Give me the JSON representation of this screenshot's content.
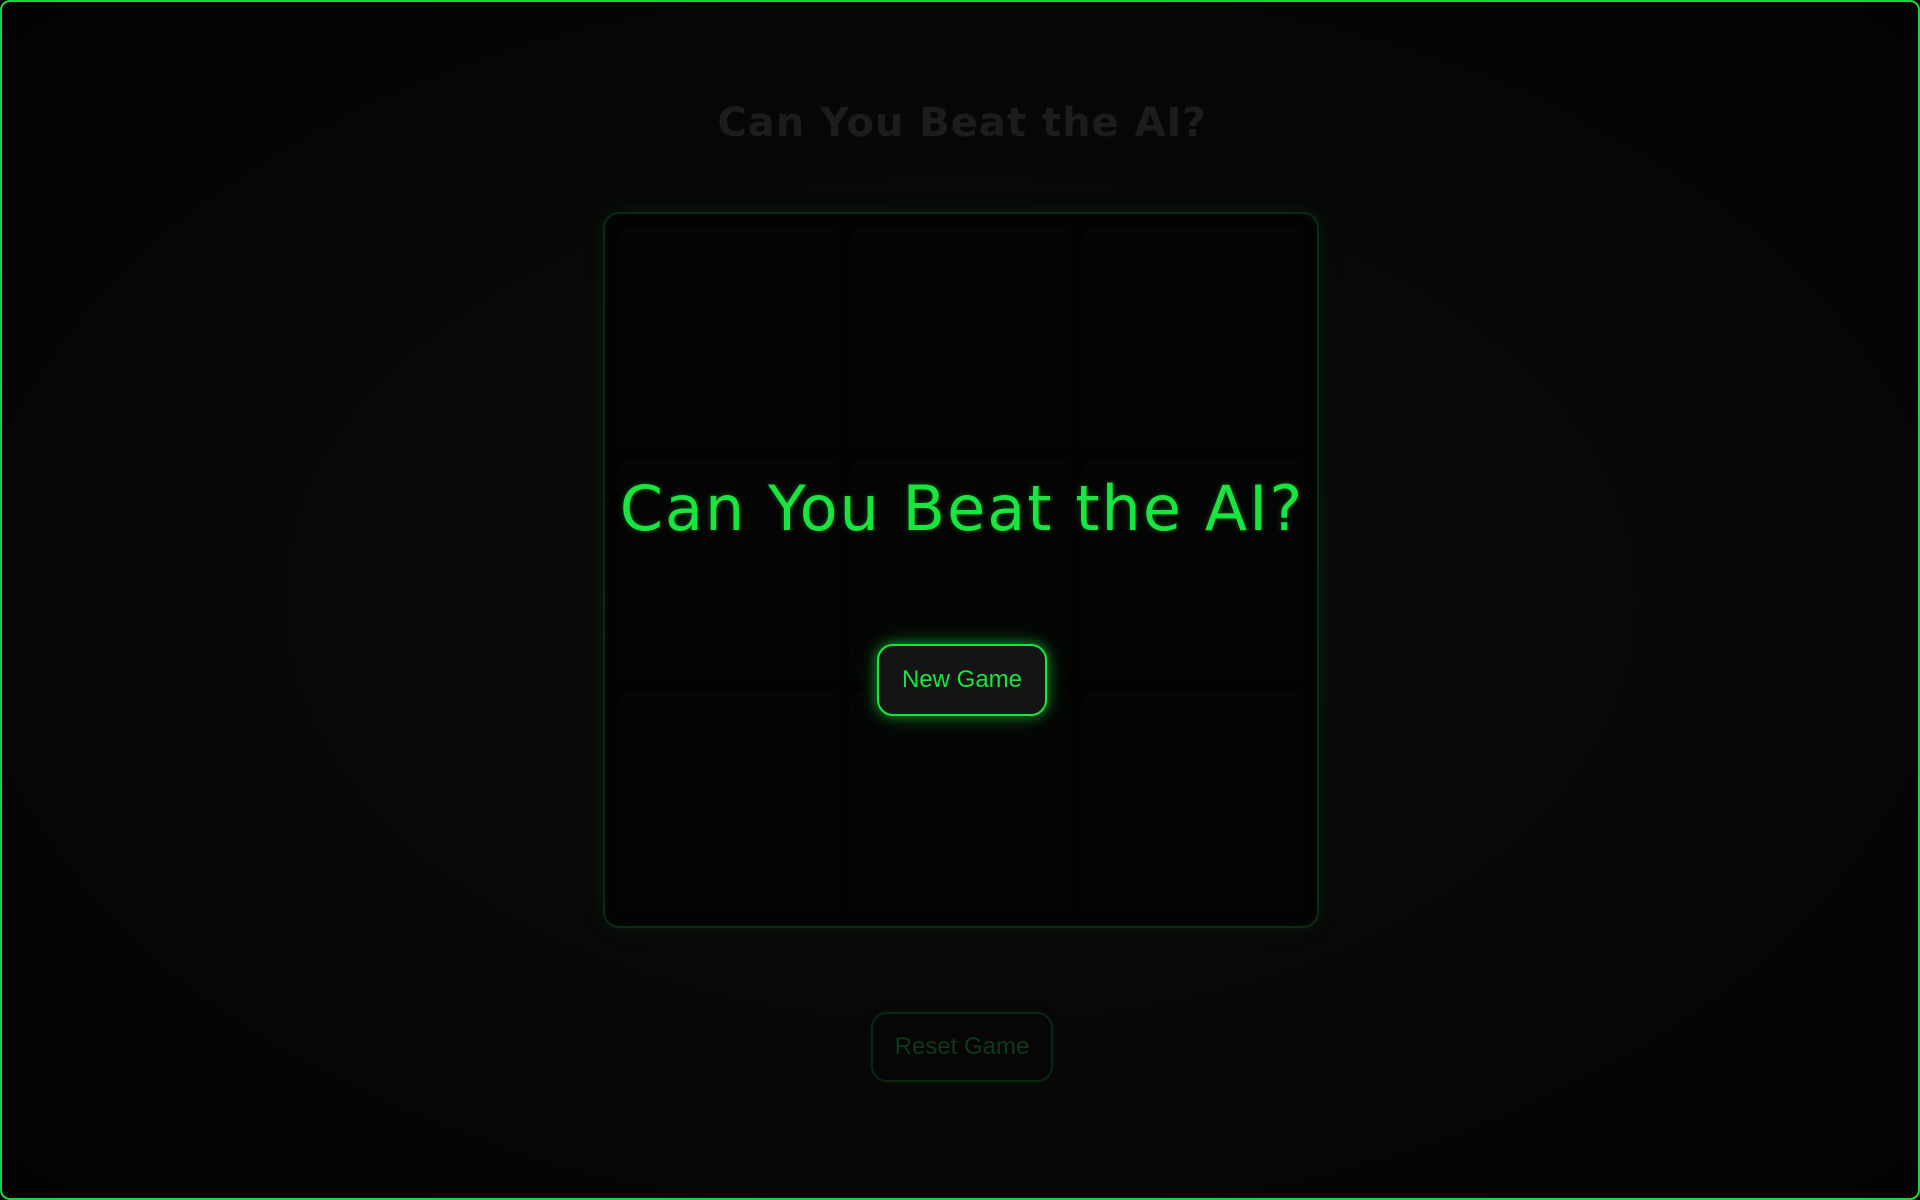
{
  "game": {
    "title": "Can You Beat the AI?",
    "reset_label": "Reset Game",
    "board_cells": [
      "",
      "",
      "",
      "",
      "",
      "",
      "",
      "",
      ""
    ]
  },
  "overlay": {
    "title": "Can You Beat the AI?",
    "new_game_label": "New Game"
  },
  "colors": {
    "accent": "#18e63e",
    "background": "#000000"
  }
}
